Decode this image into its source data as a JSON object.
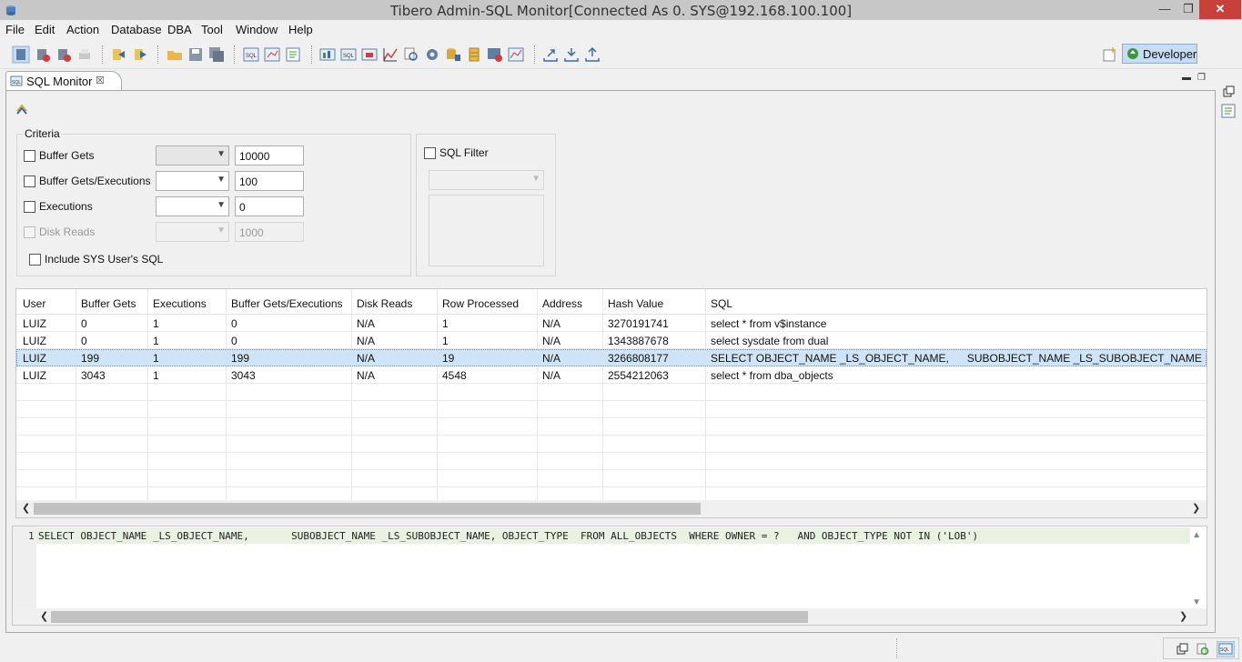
{
  "window": {
    "title": "Tibero Admin-SQL Monitor[Connected As 0. SYS@192.168.100.100]",
    "minimize": "—",
    "restore": "❐",
    "close": "✕"
  },
  "menu": [
    "File",
    "Edit",
    "Action",
    "Database",
    "DBA",
    "Tool",
    "Window",
    "Help"
  ],
  "perspective": {
    "label": "Developer"
  },
  "tab": {
    "label": "SQL Monitor",
    "close": "☒"
  },
  "criteria": {
    "title": "Criteria",
    "buffer_gets": {
      "label": "Buffer Gets",
      "value": "10000"
    },
    "buffer_gets_exec": {
      "label": "Buffer Gets/Executions",
      "value": "100"
    },
    "executions": {
      "label": "Executions",
      "value": "0"
    },
    "disk_reads": {
      "label": "Disk Reads",
      "value": "1000"
    },
    "include_sys": {
      "label": "Include SYS User's SQL"
    }
  },
  "sql_filter": {
    "label": "SQL Filter"
  },
  "table": {
    "columns": [
      "User",
      "Buffer Gets",
      "Executions",
      "Buffer Gets/Executions",
      "Disk Reads",
      "Row Processed",
      "Address",
      "Hash Value",
      "SQL"
    ],
    "rows": [
      [
        "LUIZ",
        "0",
        "1",
        "0",
        "N/A",
        "1",
        "N/A",
        "3270191741",
        "select * from v$instance"
      ],
      [
        "LUIZ",
        "0",
        "1",
        "0",
        "N/A",
        "1",
        "N/A",
        "1343887678",
        "select sysdate from dual"
      ],
      [
        "LUIZ",
        "199",
        "1",
        "199",
        "N/A",
        "19",
        "N/A",
        "3266808177",
        "SELECT OBJECT_NAME _LS_OBJECT_NAME,      SUBOBJECT_NAME _LS_SUBOBJECT_NAME, OBJECT_TYPE"
      ],
      [
        "LUIZ",
        "3043",
        "1",
        "3043",
        "N/A",
        "4548",
        "N/A",
        "2554212063",
        "select * from dba_objects"
      ]
    ],
    "selected_row": 2
  },
  "sql_editor": {
    "line_number": "1",
    "text": "SELECT OBJECT_NAME _LS_OBJECT_NAME,       SUBOBJECT_NAME _LS_SUBOBJECT_NAME, OBJECT_TYPE  FROM ALL_OBJECTS  WHERE OWNER = ?   AND OBJECT_TYPE NOT IN ('LOB')"
  },
  "colors": {
    "selected_row": "#cfe4f7",
    "sql_line_highlight": "#e8f2e3",
    "close_button": "#c7403a"
  }
}
